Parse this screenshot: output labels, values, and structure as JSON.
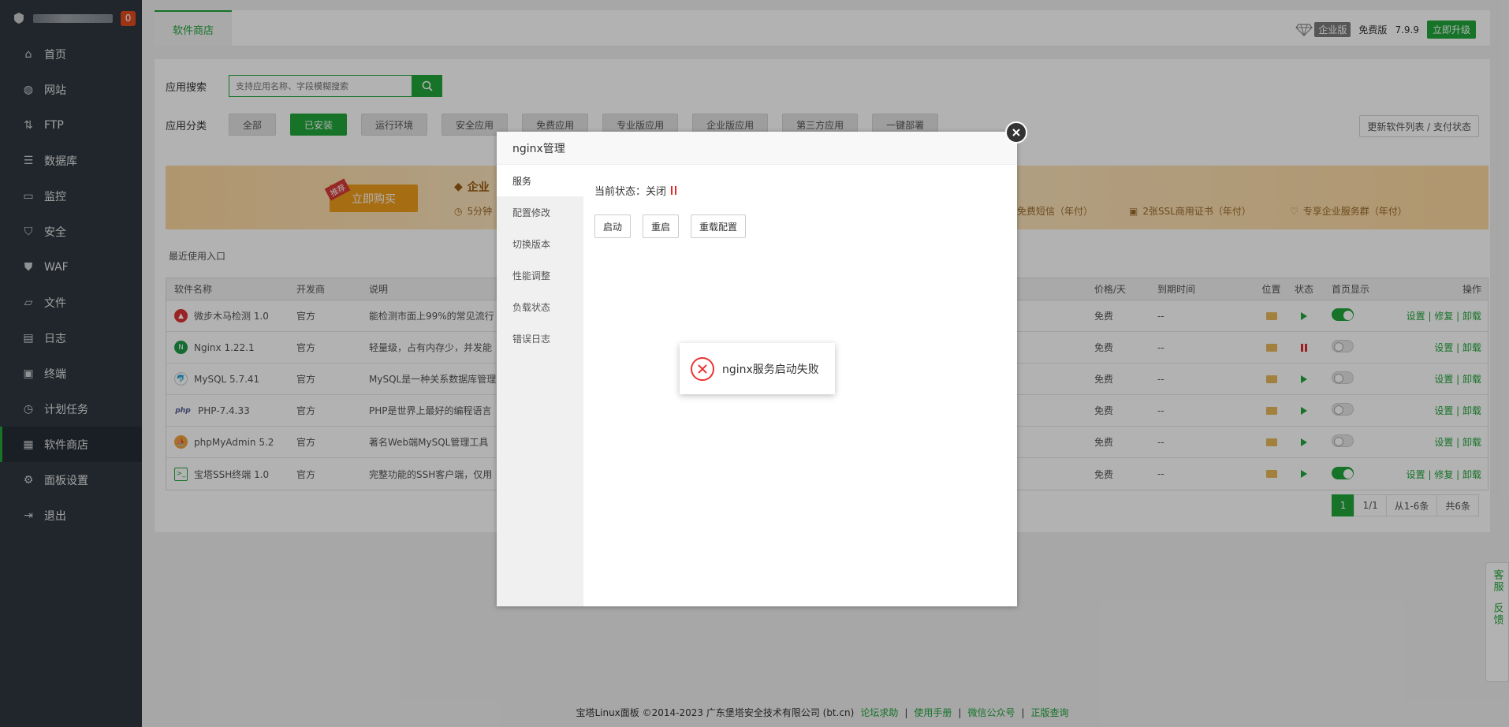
{
  "sidebar": {
    "badge": "0",
    "items": [
      {
        "label": "首页",
        "icon": "home-icon"
      },
      {
        "label": "网站",
        "icon": "globe-icon"
      },
      {
        "label": "FTP",
        "icon": "ftp-icon"
      },
      {
        "label": "数据库",
        "icon": "database-icon"
      },
      {
        "label": "监控",
        "icon": "monitor-icon"
      },
      {
        "label": "安全",
        "icon": "shield-icon"
      },
      {
        "label": "WAF",
        "icon": "waf-shield-icon"
      },
      {
        "label": "文件",
        "icon": "folder-icon"
      },
      {
        "label": "日志",
        "icon": "log-icon"
      },
      {
        "label": "终端",
        "icon": "terminal-icon"
      },
      {
        "label": "计划任务",
        "icon": "clock-icon"
      },
      {
        "label": "软件商店",
        "icon": "grid-icon",
        "active": true
      },
      {
        "label": "面板设置",
        "icon": "gear-icon"
      },
      {
        "label": "退出",
        "icon": "logout-icon"
      }
    ]
  },
  "header": {
    "tab": "软件商店",
    "enterprise_label": "企业版",
    "edition": "免费版",
    "version": "7.9.9",
    "upgrade": "立即升级"
  },
  "search": {
    "label": "应用搜索",
    "placeholder": "支持应用名称、字段模糊搜索"
  },
  "category": {
    "label": "应用分类",
    "buttons": [
      "全部",
      "已安装",
      "运行环境",
      "安全应用",
      "免费应用",
      "专业版应用",
      "企业版应用",
      "第三方应用",
      "一键部署"
    ],
    "active_index": 1,
    "refresh": "更新软件列表 / 支付状态"
  },
  "banner": {
    "recommend": "推荐",
    "buy": "立即购买",
    "title": "企业",
    "feature_left": "5分钟",
    "features": [
      "免费短信（年付）",
      "2张SSL商用证书（年付）",
      "专享企业服务群（年付）"
    ]
  },
  "recent_label": "最近使用入口",
  "table": {
    "headers": {
      "name": "软件名称",
      "dev": "开发商",
      "desc": "说明",
      "price": "价格/天",
      "expire": "到期时间",
      "loc": "位置",
      "status": "状态",
      "home": "首页显示",
      "ops": "操作"
    },
    "rows": [
      {
        "name": "微步木马检测 1.0",
        "dev": "官方",
        "desc": "能检测市面上99%的常见流行",
        "price": "免费",
        "expire": "--",
        "status": "running",
        "home": true,
        "ops": "设置 | 修复 | 卸载"
      },
      {
        "name": "Nginx 1.22.1",
        "dev": "官方",
        "desc": "轻量级，占有内存少，并发能",
        "price": "免费",
        "expire": "--",
        "status": "stopped",
        "home": false,
        "ops": "设置 | 卸载"
      },
      {
        "name": "MySQL 5.7.41",
        "dev": "官方",
        "desc": "MySQL是一种关系数据库管理",
        "price": "免费",
        "expire": "--",
        "status": "running",
        "home": false,
        "ops": "设置 | 卸载"
      },
      {
        "name": "PHP-7.4.33",
        "dev": "官方",
        "desc": "PHP是世界上最好的编程语言",
        "price": "免费",
        "expire": "--",
        "status": "running",
        "home": false,
        "ops": "设置 | 卸载"
      },
      {
        "name": "phpMyAdmin 5.2",
        "dev": "官方",
        "desc": "著名Web端MySQL管理工具",
        "price": "免费",
        "expire": "--",
        "status": "running",
        "home": false,
        "ops": "设置 | 卸载"
      },
      {
        "name": "宝塔SSH终端 1.0",
        "dev": "官方",
        "desc": "完整功能的SSH客户端，仅用",
        "price": "免费",
        "expire": "--",
        "status": "running",
        "home": true,
        "ops": "设置 | 修复 | 卸载"
      }
    ]
  },
  "pager": {
    "current": "1",
    "pages": "1/1",
    "range": "从1-6条",
    "total": "共6条"
  },
  "footer": {
    "copyright": "宝塔Linux面板 ©2014-2023 广东堡塔安全技术有限公司 (bt.cn)",
    "links": [
      "论坛求助",
      "使用手册",
      "微信公众号",
      "正版查询"
    ]
  },
  "float": {
    "service": "客服",
    "feedback": "反馈"
  },
  "modal": {
    "title": "nginx管理",
    "menu": [
      "服务",
      "配置修改",
      "切换版本",
      "性能调整",
      "负载状态",
      "错误日志"
    ],
    "status_label": "当前状态：关闭",
    "buttons": [
      "启动",
      "重启",
      "重载配置"
    ]
  },
  "toast": {
    "message": "nginx服务启动失败"
  },
  "colors": {
    "accent": "#20a53a",
    "sidebar": "#2f3740",
    "error": "#e33333"
  }
}
